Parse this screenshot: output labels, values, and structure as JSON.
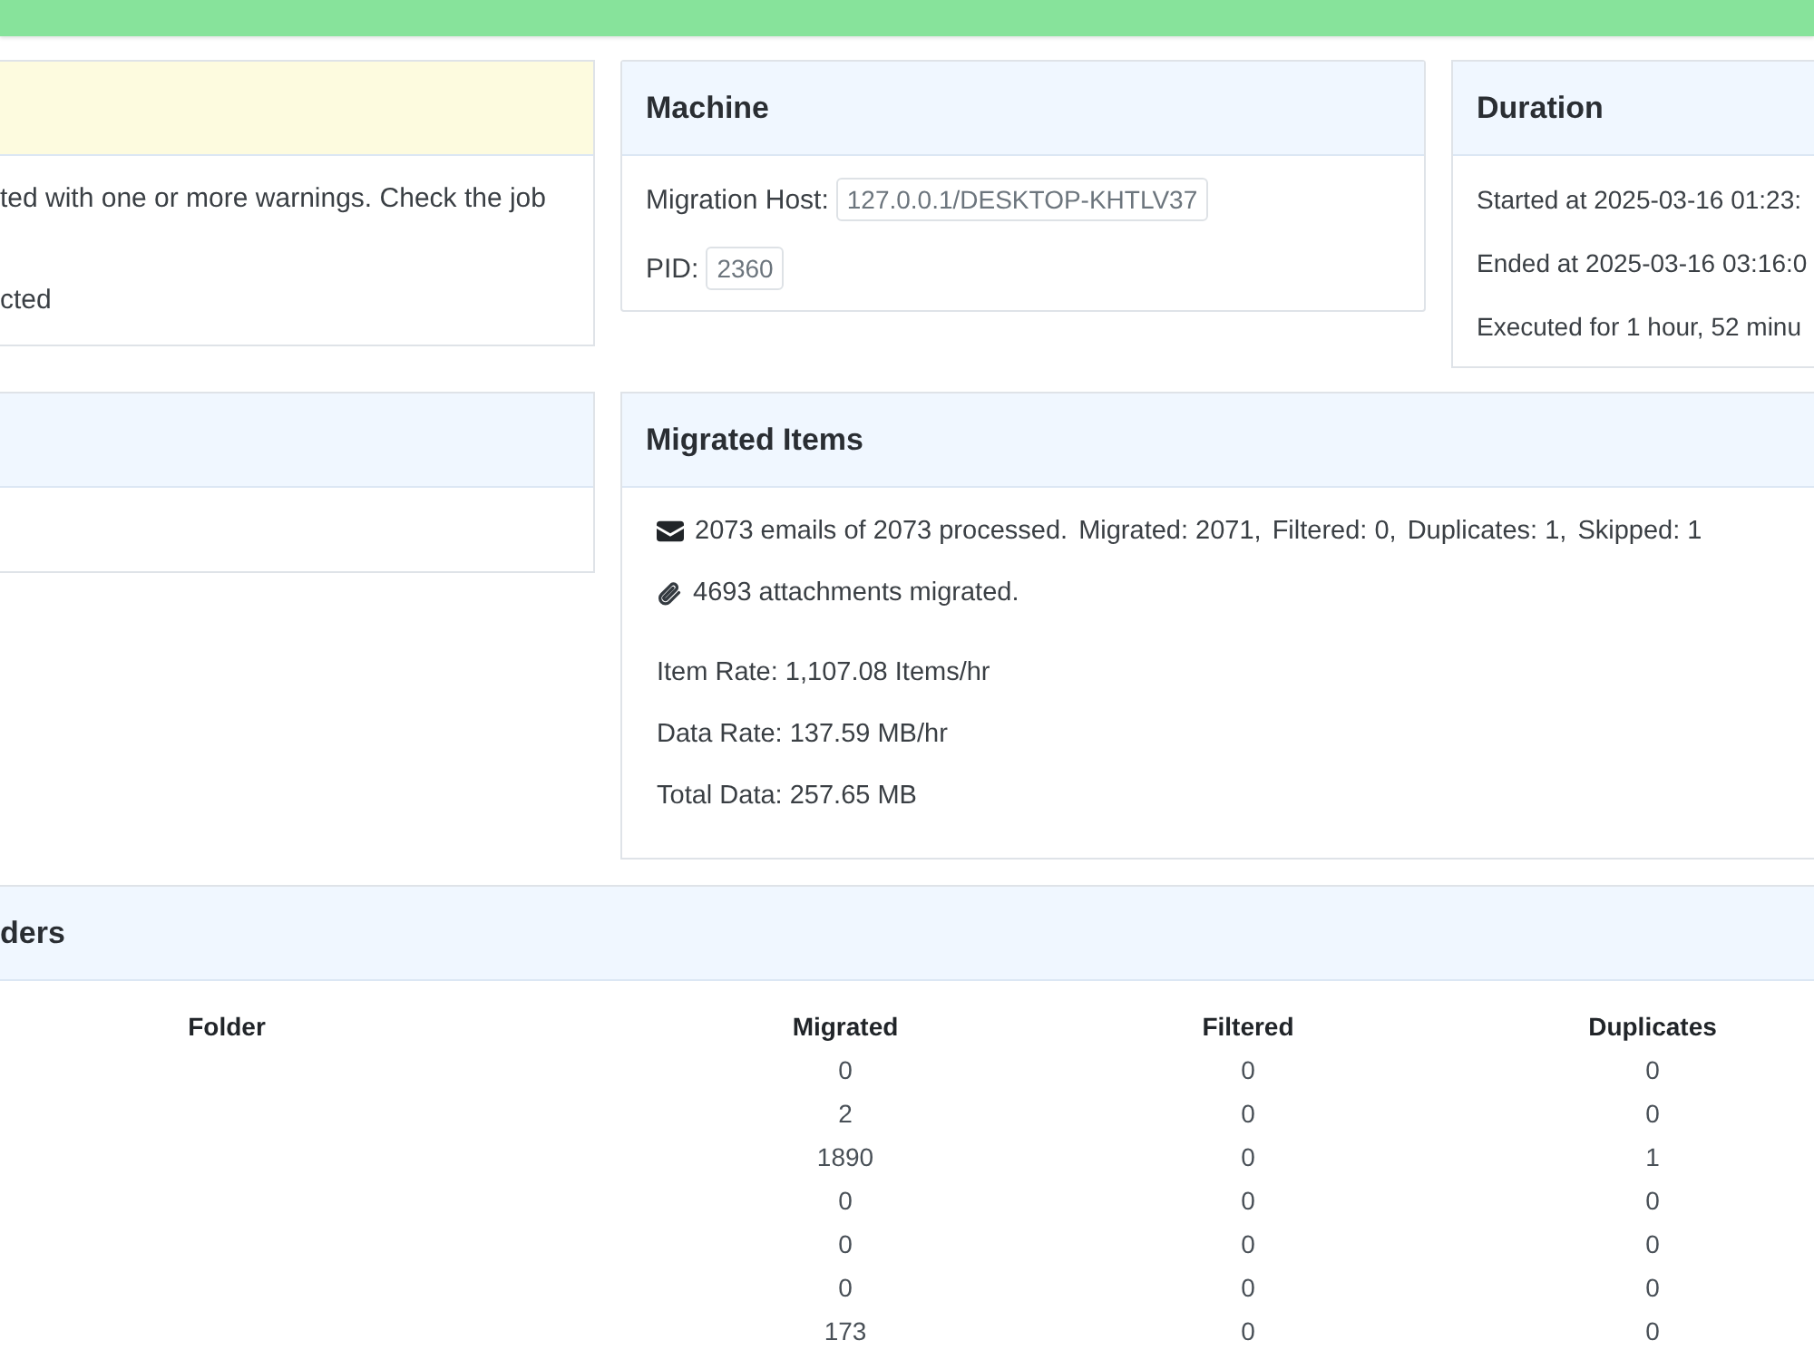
{
  "summary_panel": {
    "warning": true,
    "lines": [
      "ted with one or more warnings. Check the job",
      "cted"
    ]
  },
  "machine": {
    "title": "Machine",
    "fields": [
      {
        "label": "Migration Host:",
        "value": "127.0.0.1/DESKTOP-KHTLV37"
      },
      {
        "label": "PID:",
        "value": "2360"
      }
    ]
  },
  "duration": {
    "title": "Duration",
    "lines": [
      "Started at 2025-03-16 01:23:",
      "Ended at 2025-03-16 03:16:0",
      "Executed for 1 hour, 52 minu"
    ]
  },
  "migrated_items": {
    "title": "Migrated Items",
    "email_summary": [
      "2073 emails of 2073 processed.",
      "Migrated: 2071,",
      "Filtered: 0,",
      "Duplicates: 1,",
      "Skipped: 1"
    ],
    "attachments": "4693 attachments migrated.",
    "rates": [
      "Item Rate: 1,107.08 Items/hr",
      "Data Rate: 137.59 MB/hr",
      "Total Data: 257.65 MB"
    ]
  },
  "folders": {
    "title": "ders",
    "columns": [
      "Folder",
      "Migrated",
      "Filtered",
      "Duplicates"
    ],
    "rows": [
      {
        "migrated": "0",
        "filtered": "0",
        "duplicates": "0"
      },
      {
        "migrated": "2",
        "filtered": "0",
        "duplicates": "0"
      },
      {
        "migrated": "1890",
        "filtered": "0",
        "duplicates": "1"
      },
      {
        "migrated": "0",
        "filtered": "0",
        "duplicates": "0"
      },
      {
        "migrated": "0",
        "filtered": "0",
        "duplicates": "0"
      },
      {
        "migrated": "0",
        "filtered": "0",
        "duplicates": "0"
      },
      {
        "migrated": "173",
        "filtered": "0",
        "duplicates": "0"
      }
    ]
  }
}
